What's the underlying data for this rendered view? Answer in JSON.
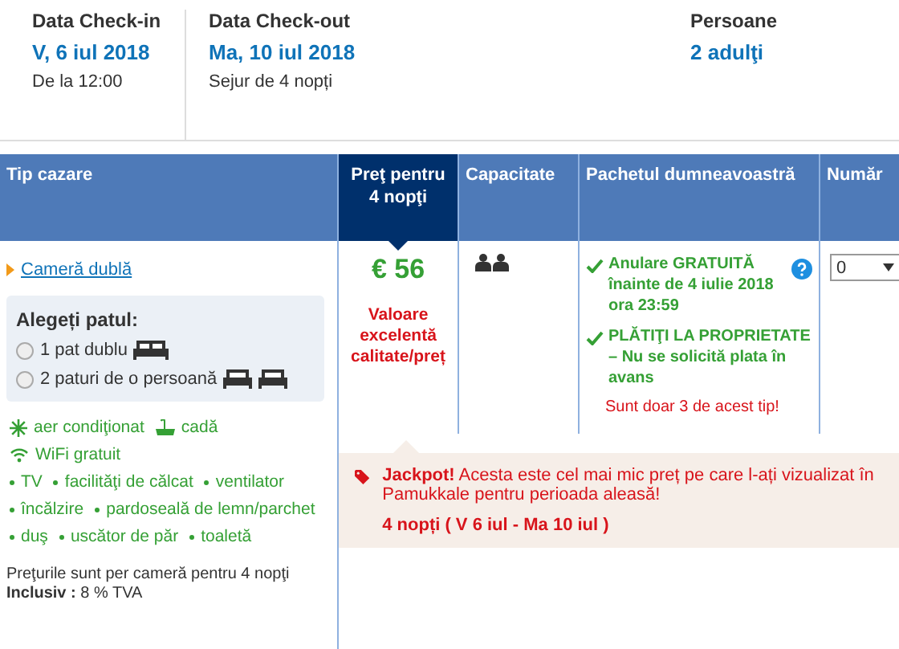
{
  "summary": [
    {
      "label": "Data Check-in",
      "value": "V, 6 iul 2018",
      "note": "De la 12:00"
    },
    {
      "label": "Data Check-out",
      "value": "Ma, 10 iul 2018",
      "note": "Sejur de 4 nopți"
    },
    {
      "label": "Persoane",
      "value": "2 adulţi"
    }
  ],
  "table": {
    "columns": [
      {
        "label": "Tip cazare",
        "selected": false
      },
      {
        "label": "Preţ pentru 4 nopţi",
        "selected": true
      },
      {
        "label": "Capacitate",
        "selected": false
      },
      {
        "label": "Pachetul dumneavoastră",
        "selected": false
      },
      {
        "label": "Număr",
        "selected": false
      }
    ],
    "room": {
      "name": "Cameră dublă",
      "bed_title": "Alegeți patul:",
      "beds": [
        {
          "label": "1 pat dublu",
          "kind": "double",
          "selected": false
        },
        {
          "label": "2 paturi de o persoană",
          "kind": "twin",
          "selected": false
        }
      ],
      "amenities": [
        {
          "label": "aer condiţionat",
          "kind": "snow"
        },
        {
          "label": "cadă",
          "kind": "bath"
        },
        {
          "label": "WiFi gratuit",
          "kind": "wifi"
        },
        {
          "label": "TV",
          "kind": "bullet"
        },
        {
          "label": "facilităţi de călcat",
          "kind": "bullet"
        },
        {
          "label": "ventilator",
          "kind": "bullet"
        },
        {
          "label": "încălzire",
          "kind": "bullet"
        },
        {
          "label": "pardoseală de lemn/parchet",
          "kind": "bullet"
        },
        {
          "label": "duş",
          "kind": "bullet"
        },
        {
          "label": "uscător de păr",
          "kind": "bullet"
        },
        {
          "label": "toaletă",
          "kind": "bullet"
        }
      ],
      "price_note": "Preţurile sunt per cameră pentru 4 nopţi",
      "tax": "**Inclusiv :** 8 % TVA"
    },
    "price": "€ 56",
    "value_note": "Valoare excelentă calitate/preț",
    "packages": [
      "Anulare GRATUITĂ înainte de 4 iulie 2018 ora 23:59",
      "PLĂTIŢI LA PROPRIETATE – Nu se solicită plata în avans"
    ],
    "scarcity": "Sunt doar 3 de acest tip!",
    "quantity": "0",
    "jackpot": {
      "text": "**Jackpot!** Acesta este cel mai mic preț pe care l-ați vizualizat în Pamukkale pentru perioada aleasă!",
      "dates": "4 nopți ( V 6 iul - Ma 10 iul )"
    }
  }
}
